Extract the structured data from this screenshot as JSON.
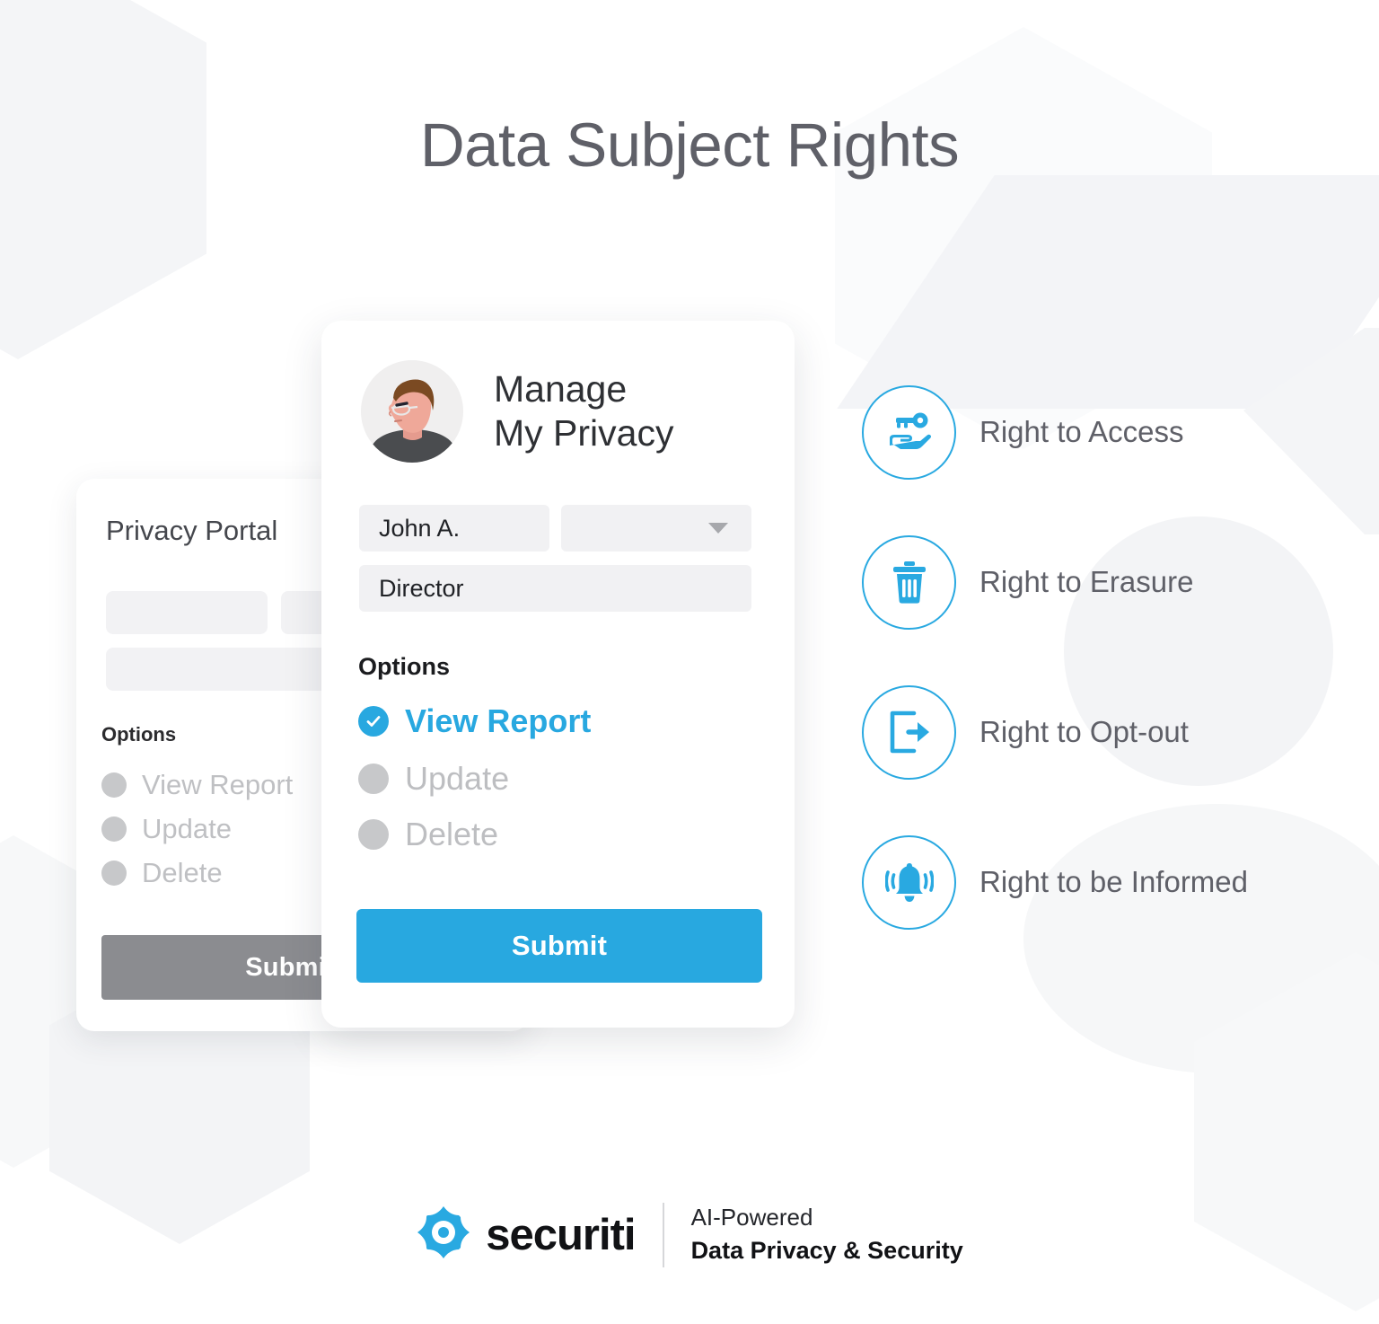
{
  "page": {
    "title": "Data Subject Rights",
    "accent_color": "#28a8e0",
    "title_color": "#5f6068"
  },
  "back_card": {
    "title": "Privacy Portal",
    "options_label": "Options",
    "options": [
      {
        "label": "View Report",
        "selected": false
      },
      {
        "label": "Update",
        "selected": false
      },
      {
        "label": "Delete",
        "selected": false
      }
    ],
    "submit_label": "Submit",
    "submit_color": "#8b8c90"
  },
  "main_card": {
    "avatar_icon": "user-avatar-illustration",
    "title": "Manage\nMy Privacy",
    "fields": {
      "name": {
        "value": "John A.",
        "placeholder": ""
      },
      "select": {
        "value": "",
        "placeholder": "",
        "caret_icon": "chevron-down-icon"
      },
      "role": {
        "value": "Director",
        "placeholder": ""
      }
    },
    "options_label": "Options",
    "options": [
      {
        "label": "View Report",
        "selected": true,
        "icon": "check-circle-icon"
      },
      {
        "label": "Update",
        "selected": false,
        "icon": "radio-dot-icon"
      },
      {
        "label": "Delete",
        "selected": false,
        "icon": "radio-dot-icon"
      }
    ],
    "submit_label": "Submit",
    "submit_color": "#28a8e0"
  },
  "rights": [
    {
      "label": "Right to Access",
      "icon": "key-in-hand-icon"
    },
    {
      "label": "Right to Erasure",
      "icon": "trash-icon"
    },
    {
      "label": "Right to Opt-out",
      "icon": "exit-arrow-icon"
    },
    {
      "label": "Right to be Informed",
      "icon": "ringing-bell-icon"
    }
  ],
  "footer": {
    "logo_icon": "securiti-mark-icon",
    "brand": "securiti",
    "tagline_line1": "AI-Powered",
    "tagline_line2": "Data Privacy & Security"
  }
}
